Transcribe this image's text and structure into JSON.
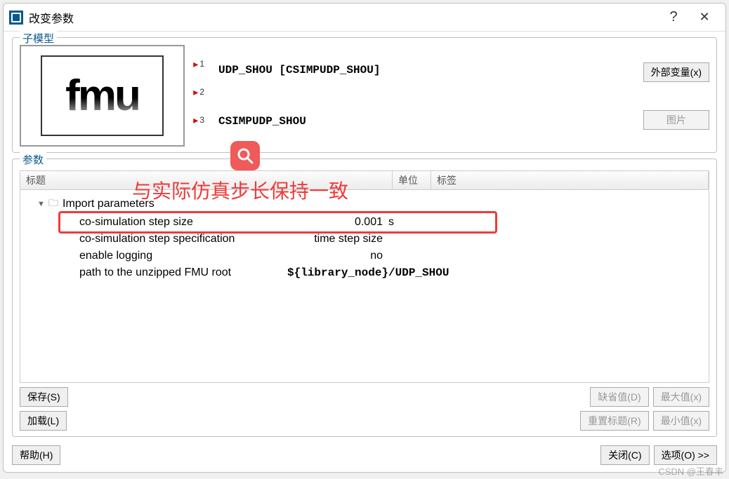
{
  "window": {
    "title": "改变参数"
  },
  "groups": {
    "submodel": "子模型",
    "params": "参数"
  },
  "submodel": {
    "icon_text": "fmu",
    "ports": [
      "1",
      "2",
      "3"
    ],
    "line1": "UDP_SHOU [CSIMPUDP_SHOU]",
    "line2": "CSIMPUDP_SHOU",
    "ext_var_btn": "外部变量(x)",
    "image_btn": "图片"
  },
  "annotation": {
    "text": "与实际仿真步长保持一致"
  },
  "param_header": {
    "title": "标题",
    "unit": "单位",
    "tag": "标签"
  },
  "param_tree": {
    "group_name": "Import parameters",
    "rows": [
      {
        "name": "co-simulation step size",
        "value": "0.001",
        "unit": "s",
        "highlighted": true
      },
      {
        "name": "co-simulation step specification",
        "value": "time step size",
        "unit": ""
      },
      {
        "name": "enable logging",
        "value": "no",
        "unit": ""
      },
      {
        "name": "path to the unzipped FMU root",
        "value": "${library_node}/UDP_SHOU",
        "unit": "",
        "mono": true
      }
    ]
  },
  "buttons": {
    "save": "保存(S)",
    "load": "加载(L)",
    "default": "缺省值(D)",
    "max": "最大值(x)",
    "reset_title": "重置标题(R)",
    "min": "最小值(x)",
    "help": "帮助(H)",
    "close": "关闭(C)",
    "options": "选项(O) >>"
  },
  "watermark": "CSDN @王春丰"
}
